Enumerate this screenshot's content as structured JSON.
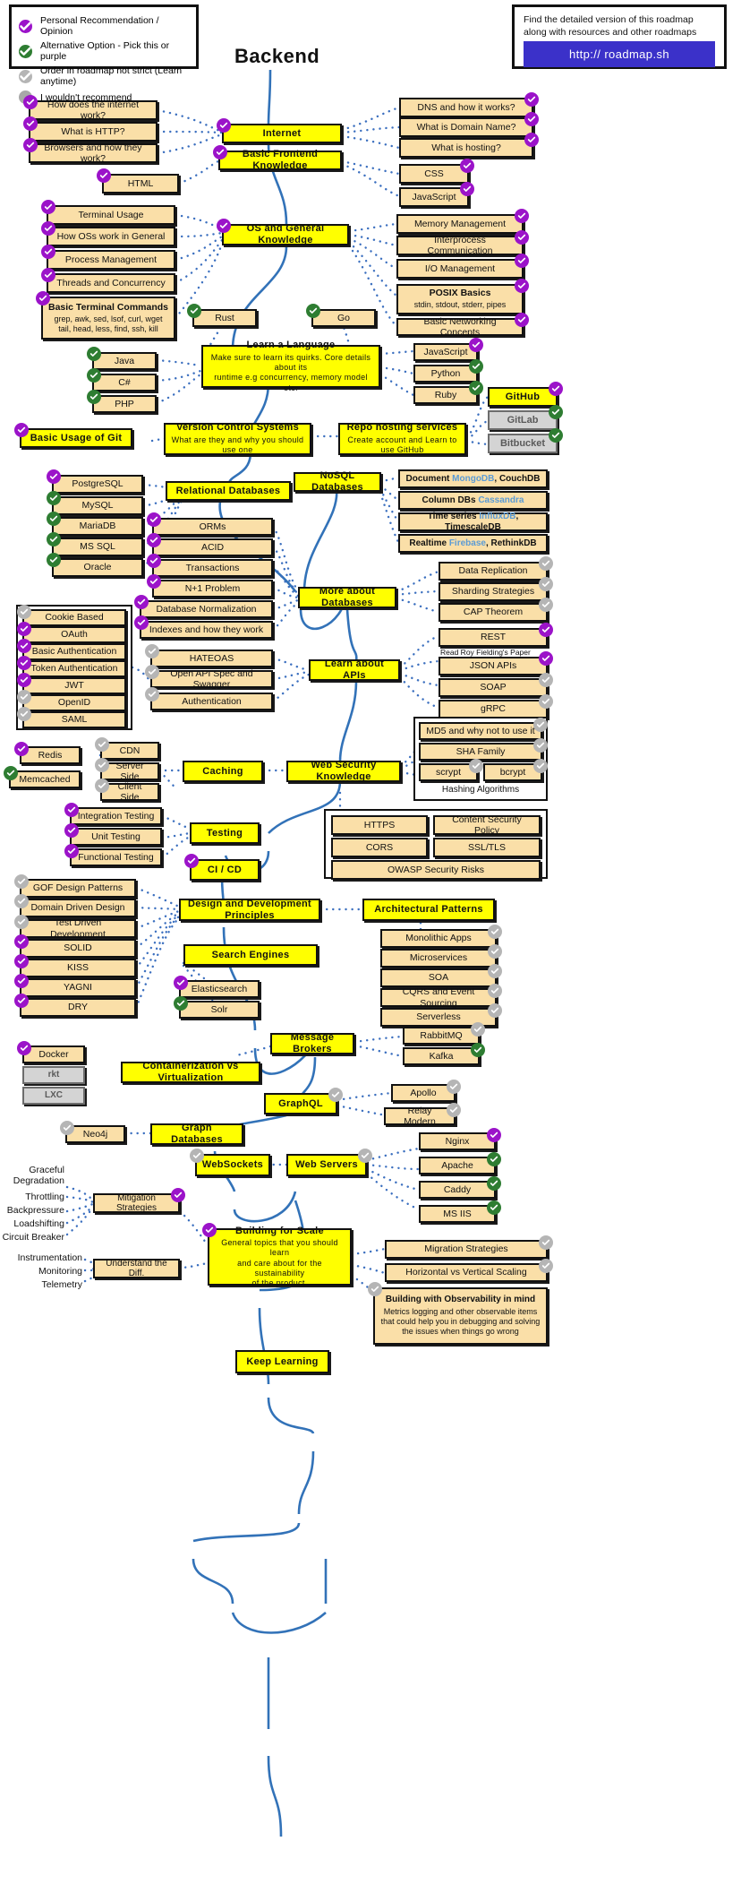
{
  "title": "Backend",
  "legend": {
    "items": [
      {
        "label": "Personal Recommendation / Opinion",
        "color": "#9b13c9",
        "icon": "check-circle-icon"
      },
      {
        "label": "Alternative Option - Pick this or purple",
        "color": "#2e7d32",
        "icon": "check-circle-icon"
      },
      {
        "label": "Order in roadmap not strict (Learn anytime)",
        "color": "#b5b5b5",
        "icon": "check-circle-icon"
      },
      {
        "label": "I wouldn't recommend",
        "color": "#a8a8a8",
        "icon": "filled-circle-icon"
      }
    ]
  },
  "info": {
    "line1": "Find the detailed version of this roadmap",
    "line2": "along with resources and other roadmaps",
    "button": "http:// roadmap.sh",
    "button_color": "#3b31c9"
  },
  "nodes": {
    "internet": "Internet",
    "basic_frontend": "Basic Frontend Knowledge",
    "how_internet": "How does the internet work?",
    "what_http": "What is HTTP?",
    "browsers": "Browsers and how they work?",
    "html": "HTML",
    "dns": "DNS and how it works?",
    "domain_name": "What is Domain Name?",
    "hosting": "What is hosting?",
    "css": "CSS",
    "javascript_fe": "JavaScript",
    "os_general": "OS and General Knowledge",
    "terminal_usage": "Terminal Usage",
    "how_os": "How OSs work in General",
    "process_mgmt": "Process Management",
    "threads": "Threads and Concurrency",
    "terminal_cmds_title": "Basic Terminal Commands",
    "terminal_cmds_l1": "grep, awk, sed, lsof, curl, wget",
    "terminal_cmds_l2": "tail, head, less, find, ssh, kill",
    "memory_mgmt": "Memory Management",
    "ipc": "Interprocess Communication",
    "io_mgmt": "I/O Management",
    "posix_title": "POSIX Basics",
    "posix_sub": "stdin, stdout, stderr, pipes",
    "networking": "Basic Networking Concepts",
    "rust": "Rust",
    "go": "Go",
    "learn_lang_title": "Learn a Language",
    "learn_lang_sub1": "Make sure to learn its quirks. Core details about its",
    "learn_lang_sub2": "runtime e.g concurrency, memory model etc.",
    "java": "Java",
    "csharp": "C#",
    "php": "PHP",
    "javascript_lang": "JavaScript",
    "python": "Python",
    "ruby": "Ruby",
    "github": "GitHub",
    "gitlab": "GitLab",
    "bitbucket": "Bitbucket",
    "git_usage": "Basic Usage of Git",
    "vcs_title": "Version Control Systems",
    "vcs_sub": "What are they and why you should use one",
    "repo_title": "Repo hosting services",
    "repo_sub": "Create account and Learn to use GitHub",
    "relational": "Relational Databases",
    "nosql": "NoSQL Databases",
    "postgresql": "PostgreSQL",
    "mysql": "MySQL",
    "mariadb": "MariaDB",
    "mssql": "MS SQL",
    "oracle": "Oracle",
    "nosql_document_a": "Document",
    "nosql_document_b": "MongoDB",
    "nosql_document_c": ", CouchDB",
    "nosql_column_a": "Column DBs",
    "nosql_column_b": "Cassandra",
    "nosql_time_a": "Time series",
    "nosql_time_b": "InfluxDB",
    "nosql_time_c": ", TimescaleDB",
    "nosql_realtime_a": "Realtime",
    "nosql_realtime_b": "Firebase",
    "nosql_realtime_c": ", RethinkDB",
    "orms": "ORMs",
    "acid": "ACID",
    "transactions": "Transactions",
    "n1": "N+1 Problem",
    "db_normalization": "Database Normalization",
    "indexes": "Indexes and how they work",
    "more_db": "More about Databases",
    "data_replication": "Data Replication",
    "sharding": "Sharding Strategies",
    "cap": "CAP Theorem",
    "rest": "REST",
    "rest_note": "Read Roy Fielding's Paper",
    "json_apis": "JSON APIs",
    "soap": "SOAP",
    "grpc": "gRPC",
    "learn_apis": "Learn about APIs",
    "hateoas": "HATEOAS",
    "openapi": "Open API Spec and Swagger",
    "authentication": "Authentication",
    "cookie_based": "Cookie Based",
    "oauth": "OAuth",
    "basic_auth": "Basic Authentication",
    "token_auth": "Token Authentication",
    "jwt": "JWT",
    "openid": "OpenID",
    "saml": "SAML",
    "web_security": "Web Security Knowledge",
    "md5": "MD5 and why not to use it",
    "sha": "SHA Family",
    "scrypt": "scrypt",
    "bcrypt": "bcrypt",
    "hashing_caption": "Hashing Algorithms",
    "https": "HTTPS",
    "csp": "Content Security Policy",
    "cors": "CORS",
    "ssl_tls": "SSL/TLS",
    "owasp": "OWASP Security Risks",
    "caching": "Caching",
    "cdn": "CDN",
    "server_side": "Server Side",
    "client_side": "Client Side",
    "redis": "Redis",
    "memcached": "Memcached",
    "testing": "Testing",
    "integration_testing": "Integration Testing",
    "unit_testing": "Unit Testing",
    "functional_testing": "Functional Testing",
    "ci_cd": "CI / CD",
    "design_principles": "Design and Development Principles",
    "architectural_patterns": "Architectural Patterns",
    "gof": "GOF Design Patterns",
    "ddd": "Domain Driven Design",
    "tdd": "Test Driven Development",
    "solid": "SOLID",
    "kiss": "KISS",
    "yagni": "YAGNI",
    "dry": "DRY",
    "search_engines": "Search Engines",
    "elasticsearch": "Elasticsearch",
    "solr": "Solr",
    "monolithic": "Monolithic Apps",
    "microservices": "Microservices",
    "soa": "SOA",
    "cqrs": "CQRS and Event Sourcing",
    "serverless": "Serverless",
    "message_brokers": "Message Brokers",
    "rabbitmq": "RabbitMQ",
    "kafka": "Kafka",
    "containerization": "Containerization vs Virtualization",
    "docker": "Docker",
    "rkt": "rkt",
    "lxc": "LXC",
    "graphql": "GraphQL",
    "apollo": "Apollo",
    "relay": "Relay Modern",
    "graph_db": "Graph Databases",
    "neo4j": "Neo4j",
    "websockets": "WebSockets",
    "web_servers": "Web Servers",
    "nginx": "Nginx",
    "apache": "Apache",
    "caddy": "Caddy",
    "msiis": "MS IIS",
    "mitigation": "Mitigation Strategies",
    "graceful_1": "Graceful",
    "graceful_2": "Degradation",
    "throttling": "Throttling",
    "backpressure": "Backpressure",
    "loadshifting": "Loadshifting",
    "circuit_breaker": "Circuit Breaker",
    "understand_diff": "Understand the Diff.",
    "instrumentation": "Instrumentation",
    "monitoring": "Monitoring",
    "telemetry": "Telemetry",
    "scale_title": "Building for Scale",
    "scale_sub1": "General topics that you should learn",
    "scale_sub2": "and care about for the sustainability",
    "scale_sub3": "of the product.",
    "migration": "Migration Strategies",
    "horiz_vert": "Horizontal vs Vertical Scaling",
    "observability_title": "Building with Observability in mind",
    "observability_s1": "Metrics logging and other observable items",
    "observability_s2": "that could help you in debugging and solving",
    "observability_s3": "the issues when things go wrong",
    "keep_learning": "Keep Learning"
  }
}
